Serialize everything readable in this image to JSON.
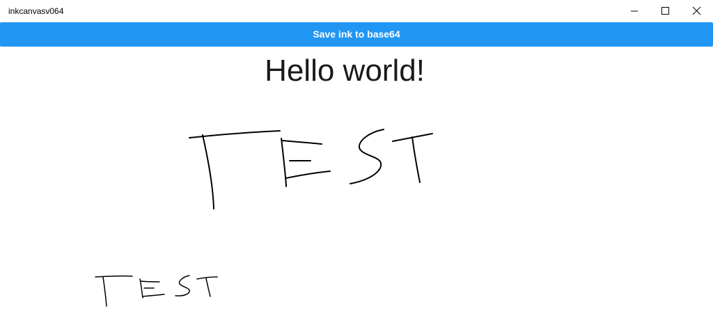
{
  "window": {
    "title": "inkcanvasv064",
    "controls": {
      "minimize_icon": "minimize-icon",
      "maximize_icon": "maximize-icon",
      "close_icon": "close-icon"
    }
  },
  "toolbar": {
    "save_label": "Save ink to base64",
    "accent_color": "#2196F3"
  },
  "main": {
    "heading": "Hello world!"
  },
  "ink": {
    "stroke_color": "#000000",
    "drawings": [
      "TEST",
      "TEST"
    ]
  }
}
